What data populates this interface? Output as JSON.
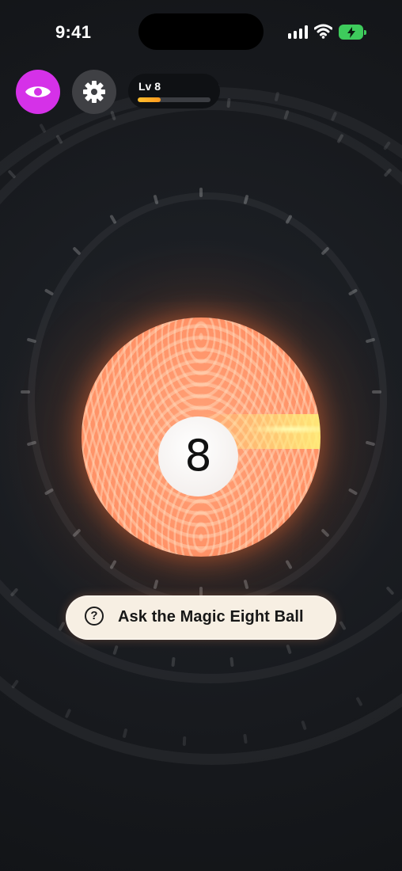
{
  "status_bar": {
    "time": "9:41",
    "battery_state": "charging",
    "icons": [
      "signal-icon",
      "wifi-icon",
      "battery-icon"
    ]
  },
  "toolbar": {
    "eye_icon": "eye-icon",
    "settings_icon": "gear-icon",
    "level_label": "Lv 8",
    "level_progress": 0.32
  },
  "ball": {
    "number": "8"
  },
  "ask_button": {
    "icon": "question-circle-icon",
    "icon_text": "?",
    "label": "Ask the Magic Eight Ball"
  },
  "colors": {
    "background": "#15181c",
    "eye_button": "#d531e8",
    "settings_button": "#3f4044",
    "ball_orange": "#ff9368",
    "ask_button_bg": "#f7efe3",
    "level_fill": "#ffbe2e",
    "battery": "#3ecb5c"
  }
}
